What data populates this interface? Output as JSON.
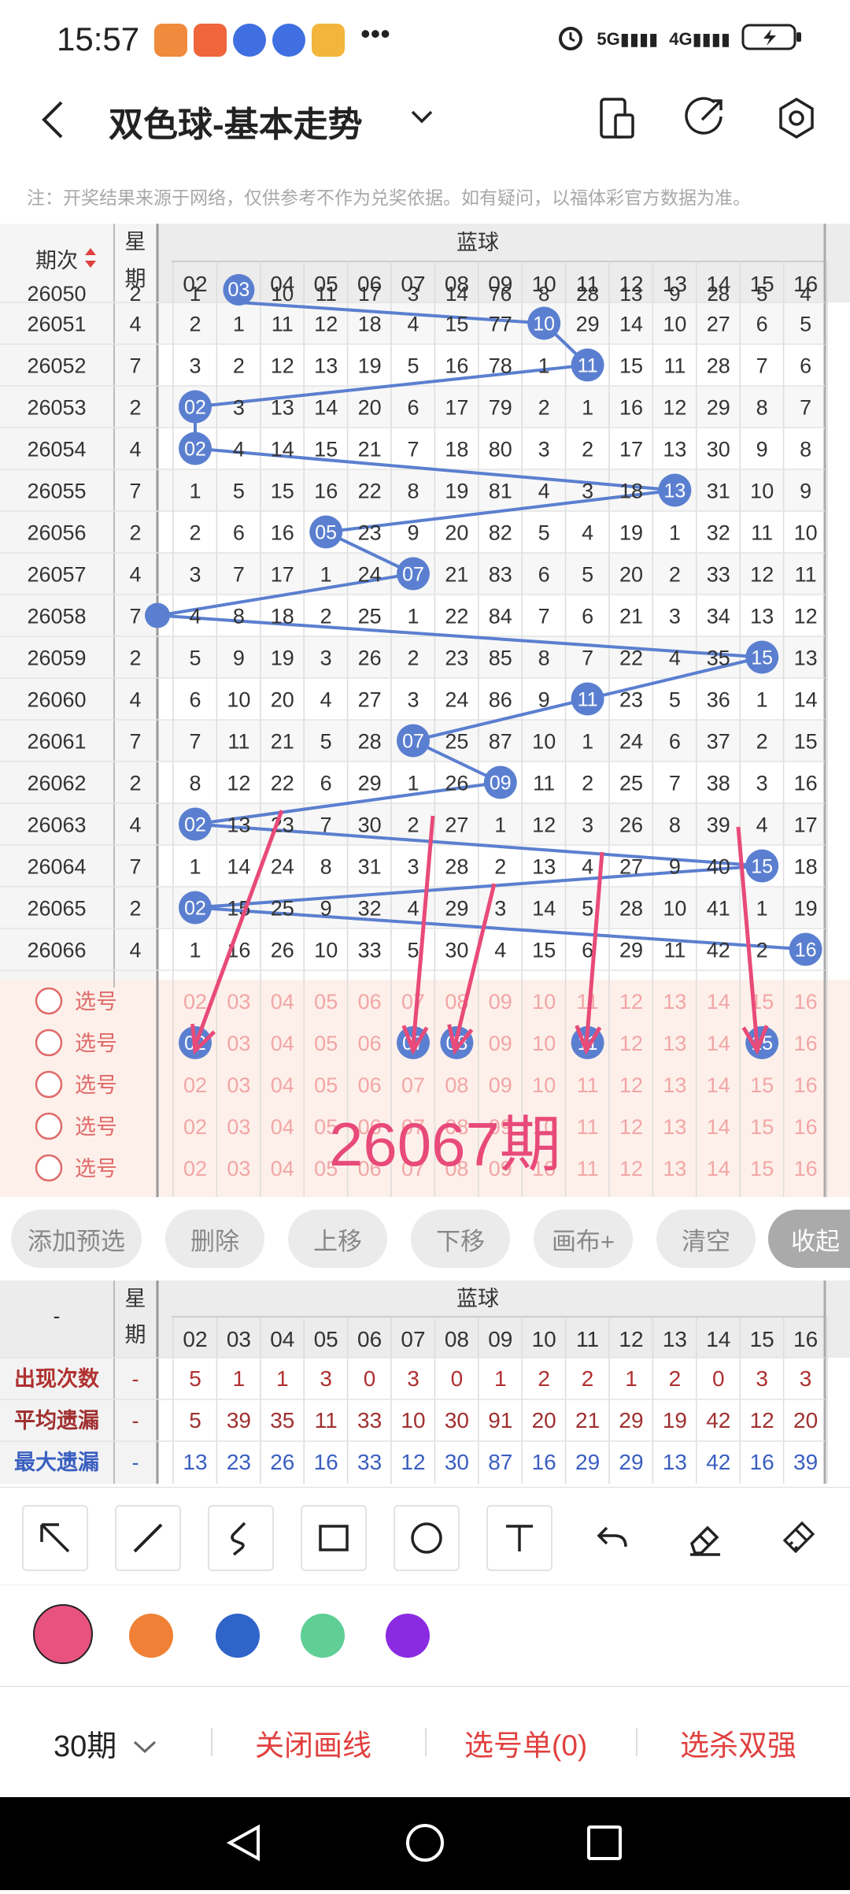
{
  "status_bar": {
    "time": "15:57",
    "signal_5g": "5G",
    "signal_4g": "4G"
  },
  "header": {
    "title": "双色球-基本走势"
  },
  "notice": "注：开奖结果来源于网络，仅供参考不作为兑奖依据。如有疑问，以福体彩官方数据为准。",
  "grid": {
    "col_period": "期次",
    "col_week": "星期",
    "group_label": "蓝球",
    "numbers": [
      "02",
      "03",
      "04",
      "05",
      "06",
      "07",
      "08",
      "09",
      "10",
      "11",
      "12",
      "13",
      "14",
      "15",
      "16"
    ],
    "partial_row": {
      "period": "26050",
      "week": "2",
      "cells": [
        "1",
        "03",
        "10",
        "11",
        "17",
        "3",
        "14",
        "76",
        "8",
        "28",
        "13",
        "9",
        "28",
        "5",
        "4"
      ]
    },
    "rows": [
      {
        "period": "26051",
        "week": "4",
        "hit": "10",
        "cells": [
          "2",
          "1",
          "11",
          "12",
          "18",
          "4",
          "15",
          "77",
          "10",
          "29",
          "14",
          "10",
          "27",
          "6",
          "5"
        ]
      },
      {
        "period": "26052",
        "week": "7",
        "hit": "11",
        "cells": [
          "3",
          "2",
          "12",
          "13",
          "19",
          "5",
          "16",
          "78",
          "1",
          "11",
          "15",
          "11",
          "28",
          "7",
          "6"
        ]
      },
      {
        "period": "26053",
        "week": "2",
        "hit": "02",
        "cells": [
          "02",
          "3",
          "13",
          "14",
          "20",
          "6",
          "17",
          "79",
          "2",
          "1",
          "16",
          "12",
          "29",
          "8",
          "7"
        ]
      },
      {
        "period": "26054",
        "week": "4",
        "hit": "02",
        "cells": [
          "02",
          "4",
          "14",
          "15",
          "21",
          "7",
          "18",
          "80",
          "3",
          "2",
          "17",
          "13",
          "30",
          "9",
          "8"
        ]
      },
      {
        "period": "26055",
        "week": "7",
        "hit": "13",
        "cells": [
          "1",
          "5",
          "15",
          "16",
          "22",
          "8",
          "19",
          "81",
          "4",
          "3",
          "18",
          "13",
          "31",
          "10",
          "9"
        ]
      },
      {
        "period": "26056",
        "week": "2",
        "hit": "05",
        "cells": [
          "2",
          "6",
          "16",
          "05",
          "23",
          "9",
          "20",
          "82",
          "5",
          "4",
          "19",
          "1",
          "32",
          "11",
          "10"
        ]
      },
      {
        "period": "26057",
        "week": "4",
        "hit": "07",
        "cells": [
          "3",
          "7",
          "17",
          "1",
          "24",
          "07",
          "21",
          "83",
          "6",
          "5",
          "20",
          "2",
          "33",
          "12",
          "11"
        ]
      },
      {
        "period": "26058",
        "week": "7",
        "hit": "01",
        "cells": [
          "4",
          "8",
          "18",
          "2",
          "25",
          "1",
          "22",
          "84",
          "7",
          "6",
          "21",
          "3",
          "34",
          "13",
          "12"
        ]
      },
      {
        "period": "26059",
        "week": "2",
        "hit": "15",
        "cells": [
          "5",
          "9",
          "19",
          "3",
          "26",
          "2",
          "23",
          "85",
          "8",
          "7",
          "22",
          "4",
          "35",
          "15",
          "13"
        ]
      },
      {
        "period": "26060",
        "week": "4",
        "hit": "11",
        "cells": [
          "6",
          "10",
          "20",
          "4",
          "27",
          "3",
          "24",
          "86",
          "9",
          "11",
          "23",
          "5",
          "36",
          "1",
          "14"
        ]
      },
      {
        "period": "26061",
        "week": "7",
        "hit": "07",
        "cells": [
          "7",
          "11",
          "21",
          "5",
          "28",
          "07",
          "25",
          "87",
          "10",
          "1",
          "24",
          "6",
          "37",
          "2",
          "15"
        ]
      },
      {
        "period": "26062",
        "week": "2",
        "hit": "09",
        "cells": [
          "8",
          "12",
          "22",
          "6",
          "29",
          "1",
          "26",
          "09",
          "11",
          "2",
          "25",
          "7",
          "38",
          "3",
          "16"
        ]
      },
      {
        "period": "26063",
        "week": "4",
        "hit": "02",
        "cells": [
          "02",
          "13",
          "23",
          "7",
          "30",
          "2",
          "27",
          "1",
          "12",
          "3",
          "26",
          "8",
          "39",
          "4",
          "17"
        ]
      },
      {
        "period": "26064",
        "week": "7",
        "hit": "15",
        "cells": [
          "1",
          "14",
          "24",
          "8",
          "31",
          "3",
          "28",
          "2",
          "13",
          "4",
          "27",
          "9",
          "40",
          "15",
          "18"
        ]
      },
      {
        "period": "26065",
        "week": "2",
        "hit": "02",
        "cells": [
          "02",
          "15",
          "25",
          "9",
          "32",
          "4",
          "29",
          "3",
          "14",
          "5",
          "28",
          "10",
          "41",
          "1",
          "19"
        ]
      },
      {
        "period": "26066",
        "week": "4",
        "hit": "16",
        "cells": [
          "1",
          "16",
          "26",
          "10",
          "33",
          "5",
          "30",
          "4",
          "15",
          "6",
          "29",
          "11",
          "42",
          "2",
          "16"
        ]
      }
    ],
    "pick_rows": [
      {
        "label": "选号",
        "selected": []
      },
      {
        "label": "选号",
        "selected": [
          "02",
          "07",
          "08",
          "11",
          "15"
        ]
      },
      {
        "label": "选号",
        "selected": []
      },
      {
        "label": "选号",
        "selected": []
      },
      {
        "label": "选号",
        "selected": []
      }
    ],
    "annotation_text": "26067期"
  },
  "actions": {
    "add": "添加预选",
    "delete": "删除",
    "up": "上移",
    "down": "下移",
    "canvas": "画布+",
    "clear": "清空",
    "collapse": "收起"
  },
  "stats": {
    "dash": "-",
    "col_week": "星期",
    "group_label": "蓝球",
    "rows": [
      {
        "label": "出现次数",
        "week": "-",
        "values": [
          "5",
          "1",
          "1",
          "3",
          "0",
          "3",
          "0",
          "1",
          "2",
          "2",
          "1",
          "2",
          "0",
          "3",
          "3"
        ]
      },
      {
        "label": "平均遗漏",
        "week": "-",
        "values": [
          "5",
          "39",
          "35",
          "11",
          "33",
          "10",
          "30",
          "91",
          "20",
          "21",
          "29",
          "19",
          "42",
          "12",
          "20"
        ]
      },
      {
        "label": "最大遗漏",
        "week": "-",
        "values": [
          "13",
          "23",
          "26",
          "16",
          "33",
          "12",
          "30",
          "87",
          "16",
          "29",
          "29",
          "13",
          "42",
          "16",
          "39"
        ]
      }
    ],
    "colors": {
      "count": "#b03030",
      "avg": "#a03030",
      "max": "#3a5fc0"
    }
  },
  "tools": [
    "arrow-icon",
    "line-icon",
    "curve-icon",
    "rectangle-icon",
    "circle-icon",
    "text-icon",
    "undo-icon",
    "eraser-icon",
    "clear-brush-icon"
  ],
  "colors": {
    "selected": "#e8527f",
    "palette": [
      "#e8527f",
      "#ef8035",
      "#2f64c9",
      "#5fcf96",
      "#8a2be2"
    ],
    "ball": "#5b7fd0",
    "line": "#5b7fd0",
    "arrow": "#e84a79"
  },
  "bottom": {
    "period": "30期",
    "close_draw": "关闭画线",
    "pick_list": "选号单(0)",
    "kill": "选杀双强"
  }
}
